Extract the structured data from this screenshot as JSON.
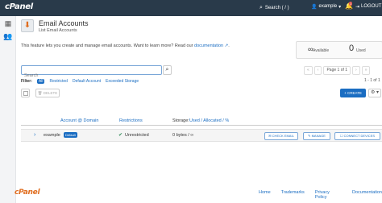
{
  "topbar": {
    "logo": "cPanel",
    "search_placeholder": "Search ( / )",
    "username": "example",
    "notifications_count": "1",
    "logout": "LOGOUT"
  },
  "header": {
    "title": "Email Accounts",
    "subtitle": "List Email Accounts",
    "intro_text": "This feature lets you create and manage email accounts. Want to learn more? Read our",
    "intro_link": "documentation"
  },
  "stats": {
    "available_value": "∞",
    "available_label": "Available",
    "used_value": "0",
    "used_label": "Used"
  },
  "search": {
    "placeholder": "Search"
  },
  "pager": {
    "first": "«",
    "prev": "‹",
    "page_label": "Page 1 of 1",
    "next": "›",
    "last": "»",
    "count": "1 - 1 of 1"
  },
  "filters": {
    "label": "Filter:",
    "items": [
      "All",
      "Restricted",
      "Default Account",
      "Exceeded Storage"
    ]
  },
  "actions": {
    "delete": "DELETE",
    "create": "+ CREATE",
    "settings": "⚙"
  },
  "table": {
    "columns": {
      "account": "Account @ Domain",
      "restrictions": "Restrictions",
      "storage_prefix": "Storage:",
      "storage_link": "Used / Allocated / %"
    },
    "rows": [
      {
        "account": "example",
        "badge": "Default",
        "restriction": "Unrestricted",
        "storage": "0 bytes / ∞",
        "buttons": [
          "CHECK EMAIL",
          "MANAGE",
          "CONNECT DEVICES"
        ]
      }
    ]
  },
  "footer": {
    "logo": "cPanel",
    "links": [
      "Home",
      "Trademarks",
      "Privacy Policy",
      "Documentation"
    ]
  }
}
